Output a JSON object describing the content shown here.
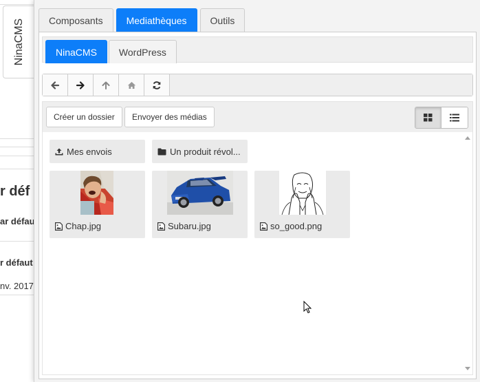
{
  "background": {
    "side_tab_label": "NinaCMS",
    "heading_fragment": "r déf",
    "line1_fragment": "ar défau",
    "line2_fragment": "r défaut",
    "date_fragment": "nv. 2017"
  },
  "tabs": [
    {
      "label": "Composants",
      "active": false
    },
    {
      "label": "Mediathèques",
      "active": true
    },
    {
      "label": "Outils",
      "active": false
    }
  ],
  "subtabs": [
    {
      "label": "NinaCMS",
      "active": true
    },
    {
      "label": "WordPress",
      "active": false
    }
  ],
  "navigation": {
    "buttons": [
      "arrow-left-icon",
      "arrow-right-icon",
      "arrow-up-icon",
      "home-icon",
      "refresh-icon"
    ],
    "path": ""
  },
  "toolbar": {
    "create_folder": "Créer un dossier",
    "upload_media": "Envoyer des médias",
    "view_mode": "grid"
  },
  "folders": [
    {
      "name": "Mes envois",
      "icon": "upload-icon"
    },
    {
      "name": "Un produit révol...",
      "icon": "folder-icon"
    }
  ],
  "files": [
    {
      "name": "Chap.jpg",
      "icon": "image-file-icon"
    },
    {
      "name": "Subaru.jpg",
      "icon": "image-file-icon"
    },
    {
      "name": "so_good.png",
      "icon": "image-file-icon"
    }
  ],
  "colors": {
    "accent": "#0d7ef9",
    "tile_bg": "#eaeaea"
  }
}
